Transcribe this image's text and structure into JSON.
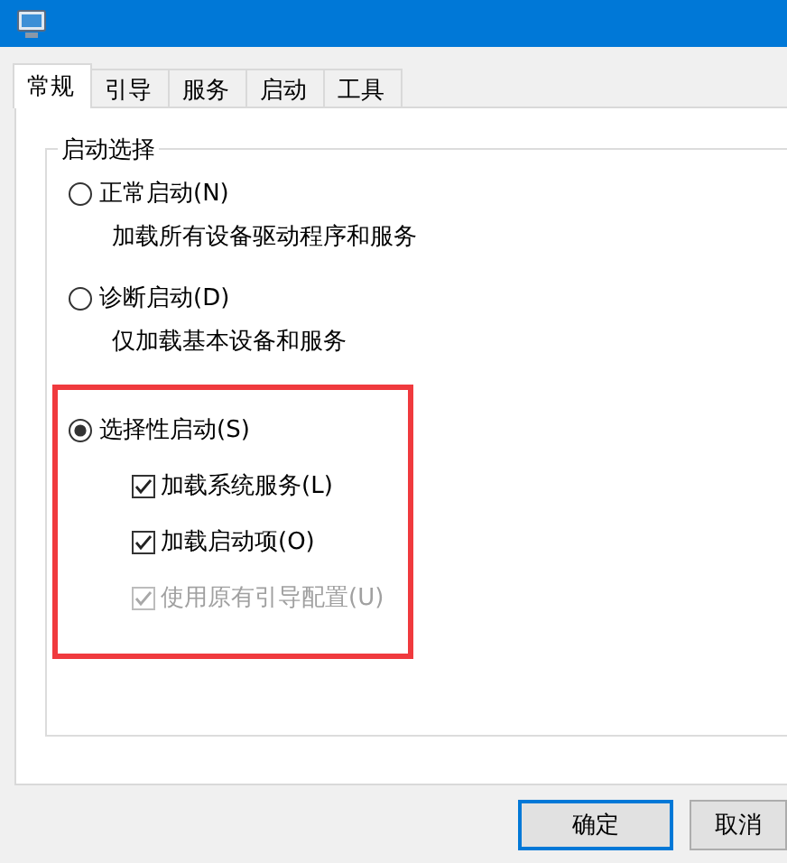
{
  "tabs": [
    {
      "label": "常规",
      "selected": true
    },
    {
      "label": "引导",
      "selected": false
    },
    {
      "label": "服务",
      "selected": false
    },
    {
      "label": "启动",
      "selected": false
    },
    {
      "label": "工具",
      "selected": false
    }
  ],
  "group": {
    "title": "启动选择",
    "options": [
      {
        "label": "正常启动(N)",
        "selected": false,
        "description": "加载所有设备驱动程序和服务"
      },
      {
        "label": "诊断启动(D)",
        "selected": false,
        "description": "仅加载基本设备和服务"
      },
      {
        "label": "选择性启动(S)",
        "selected": true,
        "highlighted": true,
        "checkboxes": [
          {
            "label": "加载系统服务(L)",
            "checked": true,
            "disabled": false
          },
          {
            "label": "加载启动项(O)",
            "checked": true,
            "disabled": false
          },
          {
            "label": "使用原有引导配置(U)",
            "checked": true,
            "disabled": true
          }
        ]
      }
    ]
  },
  "buttons": [
    {
      "label": "确定",
      "default": true
    },
    {
      "label": "取消",
      "default": false
    }
  ]
}
